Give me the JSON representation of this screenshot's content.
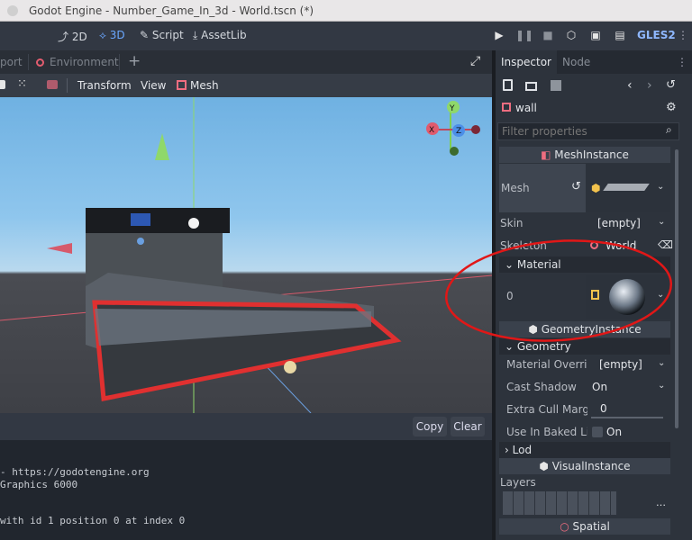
{
  "window": {
    "title": "Godot Engine - Number_Game_In_3d - World.tscn (*)"
  },
  "mainbar": {
    "view2d": "2D",
    "view3d": "3D",
    "script": "Script",
    "assetlib": "AssetLib",
    "renderer": "GLES2"
  },
  "viewport_tabs": {
    "tab_partial": "port",
    "tab_environment": "Environment"
  },
  "viewport_toolbar": {
    "transform": "Transform",
    "view": "View",
    "mesh": "Mesh"
  },
  "bottom": {
    "copy": "Copy",
    "clear": "Clear",
    "lines": [
      "- https://godotengine.org",
      "Graphics 6000",
      "",
      "with id 1 position 0 at index 0"
    ]
  },
  "inspector": {
    "tabs": {
      "inspector": "Inspector",
      "node": "Node"
    },
    "node_name": "wall",
    "filter_placeholder": "Filter properties",
    "sections": {
      "mesh_instance": "MeshInstance",
      "mesh": "Mesh",
      "skin": "Skin",
      "skin_value": "[empty]",
      "skeleton": "Skeleton",
      "skeleton_value": "World",
      "material": "Material",
      "material_index": "0",
      "geometry_instance": "GeometryInstance",
      "geometry": "Geometry",
      "material_override": "Material Overri",
      "material_override_value": "[empty]",
      "cast_shadow": "Cast Shadow",
      "cast_shadow_value": "On",
      "extra_cull": "Extra Cull Margi",
      "extra_cull_value": "0",
      "use_in_baked": "Use In Baked Li",
      "use_in_baked_value": "On",
      "lod": "Lod",
      "visual_instance": "VisualInstance",
      "layers": "Layers",
      "spatial": "Spatial"
    }
  }
}
